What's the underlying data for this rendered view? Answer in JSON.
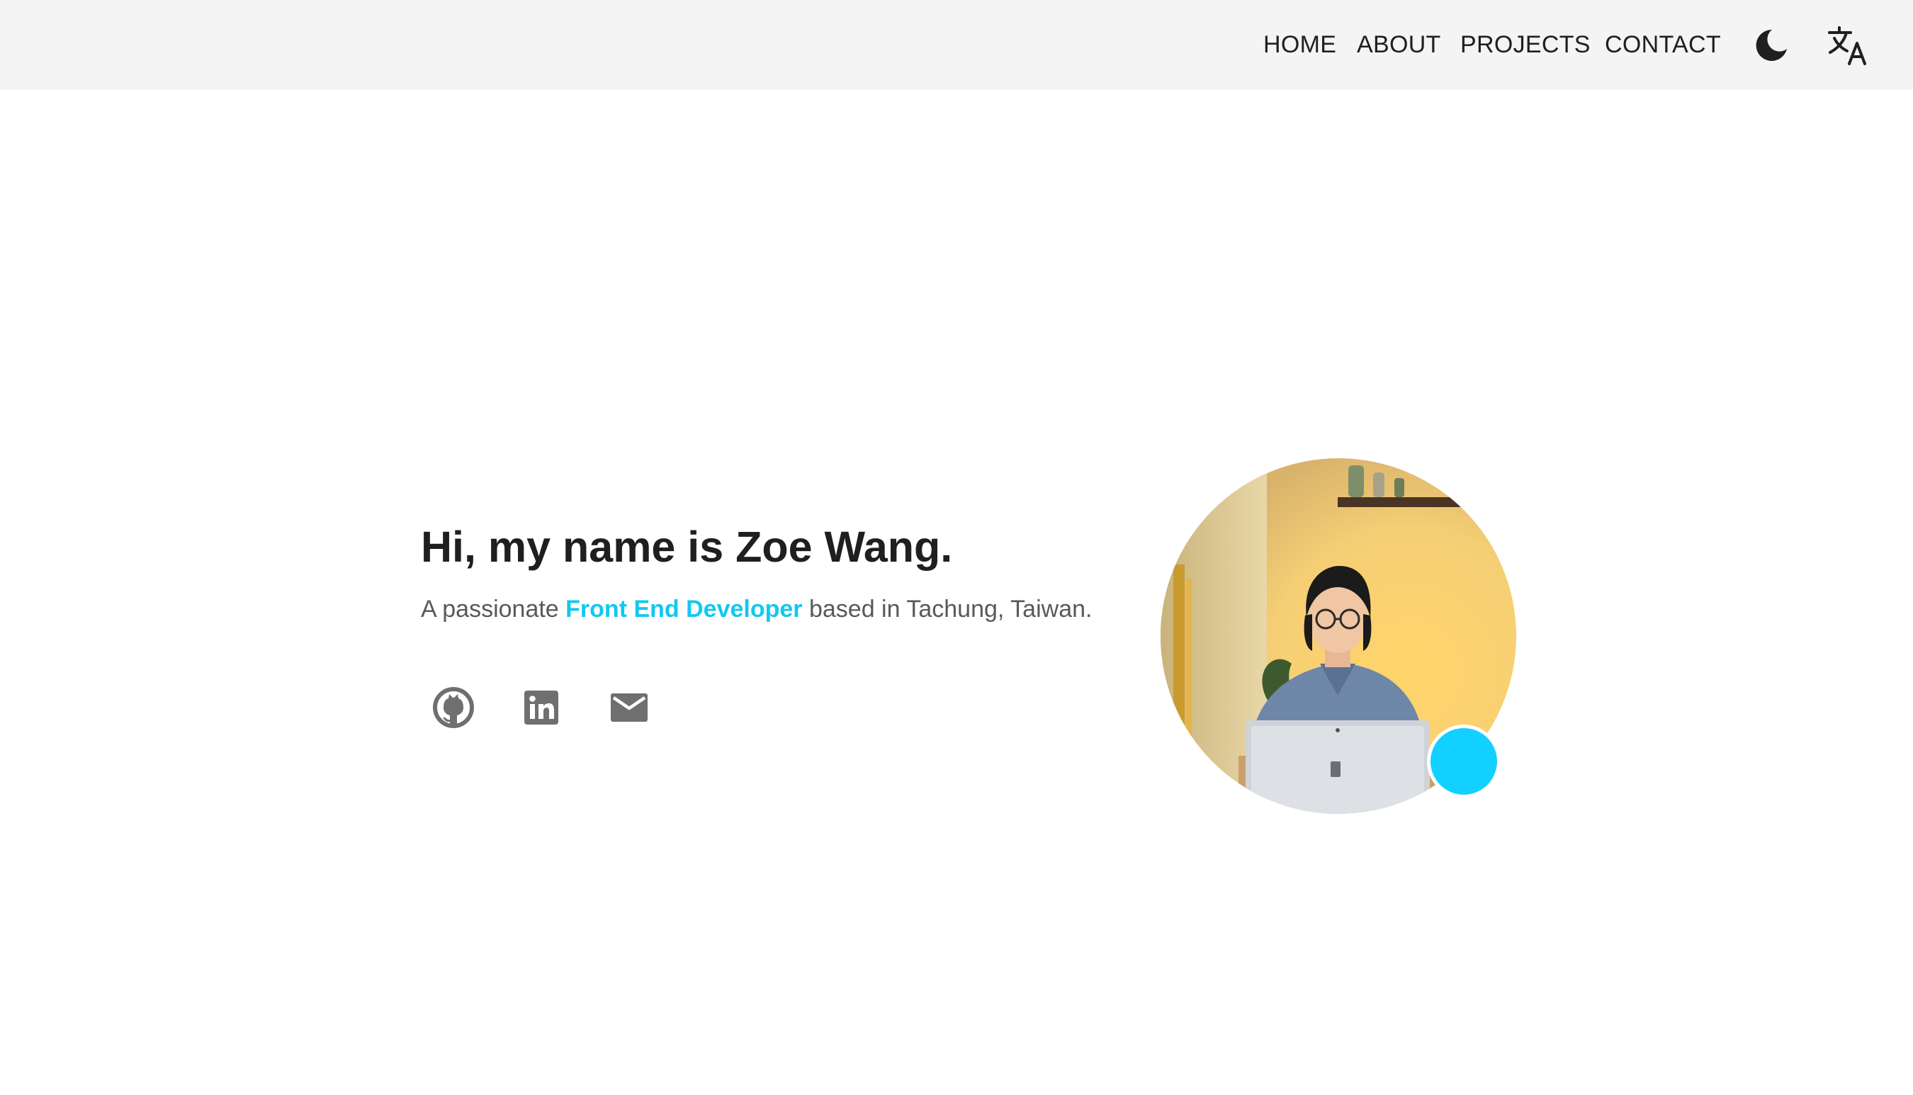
{
  "nav": {
    "links": [
      "HOME",
      "ABOUT",
      "PROJECTS",
      "CONTACT"
    ],
    "theme_toggle_icon": "moon-icon",
    "language_icon": "translate-icon"
  },
  "hero": {
    "title": "Hi, my name is Zoe Wang.",
    "subtitle_prefix": "A passionate ",
    "subtitle_highlight": "Front End Developer",
    "subtitle_suffix": " based in Tachung, Taiwan."
  },
  "social": {
    "icons": [
      "github-icon",
      "linkedin-icon",
      "mail-icon"
    ]
  },
  "colors": {
    "accent": "#12c8ef",
    "status_dot": "#12d0ff",
    "nav_background": "#f4f4f4",
    "text": "#1f1f1f",
    "muted_text": "#595959",
    "icon": "#6f6f6f"
  }
}
